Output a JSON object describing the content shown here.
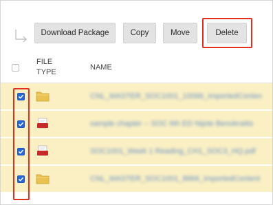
{
  "toolbar": {
    "download_label": "Download Package",
    "copy_label": "Copy",
    "move_label": "Move",
    "delete_label": "Delete"
  },
  "table": {
    "columns": [
      "FILE TYPE",
      "NAME"
    ],
    "rows": [
      {
        "file_type": "folder",
        "icon": "folder-icon",
        "checked": true,
        "name": "CNL_MASTER_SOC1001_10066_ImportedContent"
      },
      {
        "file_type": "pdf",
        "icon": "pdf-icon",
        "checked": true,
        "name": "sample chapter -- SOC 6th ED Nijole Benokraitis"
      },
      {
        "file_type": "pdf",
        "icon": "pdf-icon",
        "checked": true,
        "name": "SOC1001_Week 1 Reading_CH1_SOC3_HQ.pdf"
      },
      {
        "file_type": "folder",
        "icon": "folder-icon",
        "checked": true,
        "name": "CNL_MASTER_SOC1001_8866_ImportedContent"
      }
    ]
  },
  "colors": {
    "selected_row_bg": "#fbf0c3",
    "highlight_box": "#e0311f",
    "checkbox_checked": "#2a67d4",
    "folder": "#e9c24f",
    "pdf_red": "#c62a2a"
  }
}
